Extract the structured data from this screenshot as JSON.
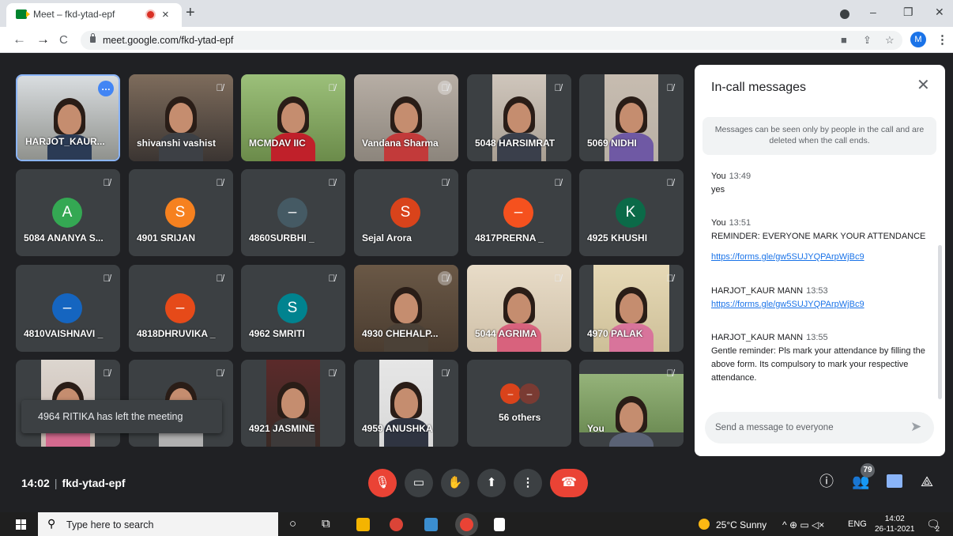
{
  "browser": {
    "tab_title": "Meet – fkd-ytad-epf",
    "tab_close": "×",
    "new_tab": "+",
    "url": "meet.google.com/fkd-ytad-epf",
    "profile_initial": "M",
    "minimize": "–",
    "restore": "❐",
    "close": "✕"
  },
  "participants": [
    {
      "name": "HARJOT_KAUR...",
      "type": "video",
      "selected": true
    },
    {
      "name": "shivanshi vashist",
      "type": "video"
    },
    {
      "name": "MCMDAV IIC",
      "type": "video"
    },
    {
      "name": "Vandana Sharma",
      "type": "video"
    },
    {
      "name": "5048 HARSIMRAT",
      "type": "video"
    },
    {
      "name": "5069 NIDHI",
      "type": "video"
    },
    {
      "name": "5084 ANANYA S...",
      "type": "avatar",
      "initial": "A",
      "color": "#34a853"
    },
    {
      "name": "4901 SRIJAN",
      "type": "avatar",
      "initial": "S",
      "color": "#f6811f"
    },
    {
      "name": "4860SURBHI _",
      "type": "avatar",
      "initial": "–",
      "color": "#455a64"
    },
    {
      "name": "Sejal Arora",
      "type": "avatar",
      "initial": "S",
      "color": "#d9431b"
    },
    {
      "name": "4817PRERNA _",
      "type": "avatar",
      "initial": "–",
      "color": "#f5511e"
    },
    {
      "name": "4925 KHUSHI",
      "type": "avatar",
      "initial": "K",
      "color": "#0b6a48"
    },
    {
      "name": "4810VAISHNAVI _",
      "type": "avatar",
      "initial": "–",
      "color": "#1565c0"
    },
    {
      "name": "4818DHRUVIKA _",
      "type": "avatar",
      "initial": "–",
      "color": "#e64a19"
    },
    {
      "name": "4962 SMRITI",
      "type": "avatar",
      "initial": "S",
      "color": "#00838f"
    },
    {
      "name": "4930 CHEHALP...",
      "type": "video"
    },
    {
      "name": "5044 AGRIMA",
      "type": "video"
    },
    {
      "name": "4970 PALAK",
      "type": "video"
    },
    {
      "name": "",
      "type": "video"
    },
    {
      "name": "",
      "type": "video"
    },
    {
      "name": "4921 JASMINE",
      "type": "video"
    },
    {
      "name": "4959 ANUSHKA",
      "type": "video"
    },
    {
      "name": "56 others",
      "type": "others"
    },
    {
      "name": "You",
      "type": "video"
    }
  ],
  "toast": "4964 RITIKA has left the meeting",
  "chat": {
    "title": "In-call messages",
    "notice": "Messages can be seen only by people in the call and are deleted when the call ends.",
    "messages": [
      {
        "sender": "You",
        "time": "13:49",
        "text": "yes",
        "link": ""
      },
      {
        "sender": "You",
        "time": "13:51",
        "text": "REMINDER: EVERYONE MARK YOUR ATTENDANCE",
        "link": "https://forms.gle/gw5SUJYQPArpWjBc9"
      },
      {
        "sender": "HARJOT_KAUR MANN",
        "time": "13:53",
        "text": "",
        "link": "https://forms.gle/gw5SUJYQPArpWjBc9"
      },
      {
        "sender": "HARJOT_KAUR MANN",
        "time": "13:55",
        "text": "Gentle reminder: Pls mark your attendance by filling the above form. Its compulsory to mark your respective attendance.",
        "link": ""
      }
    ],
    "input_placeholder": "Send a message to everyone"
  },
  "bottom": {
    "time": "14:02",
    "meeting_code": "fkd-ytad-epf",
    "participant_count": "79"
  },
  "taskbar": {
    "search_placeholder": "Type here to search",
    "weather": "25°C  Sunny",
    "lang": "ENG",
    "time": "14:02",
    "date": "26-11-2021",
    "notif_count": "2"
  },
  "colors": {
    "meet_bg": "#202124",
    "tile_bg": "#3c4043",
    "danger": "#ea4335",
    "accent": "#1a73e8"
  }
}
